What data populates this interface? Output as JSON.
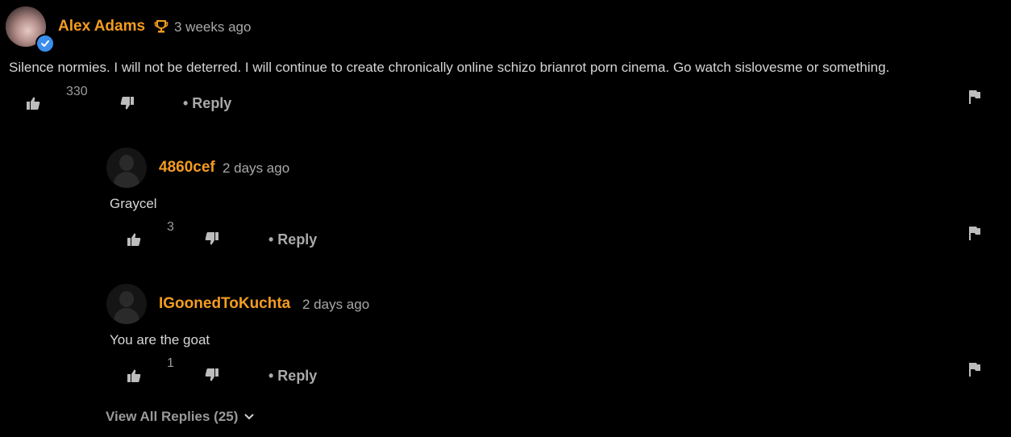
{
  "colors": {
    "username": "#f39c21",
    "background": "#000000",
    "verified": "#3b8eea"
  },
  "comment": {
    "username": "Alex Adams",
    "badge_icon": "trophy-icon",
    "time": "3 weeks ago",
    "text": "Silence normies. I will not be deterred. I will continue to create chronically online schizo brianrot porn cinema. Go watch sislovesme or something.",
    "likes": "330",
    "reply_label": "• Reply"
  },
  "replies": [
    {
      "username": "4860cef",
      "time": "2 days ago",
      "text": "Graycel",
      "likes": "3",
      "reply_label": "• Reply"
    },
    {
      "username": "IGoonedToKuchta",
      "time": "2 days ago",
      "text": "You are the goat",
      "likes": "1",
      "reply_label": "• Reply"
    }
  ],
  "view_all_label": "View All Replies (25)"
}
